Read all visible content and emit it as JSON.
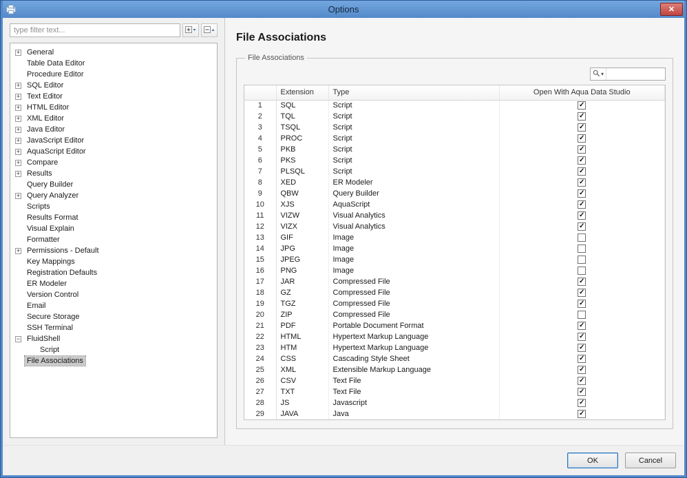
{
  "window": {
    "title": "Options",
    "close_glyph": "✕"
  },
  "colors": {
    "frame_blue": "#5489ca",
    "close_red": "#c14540",
    "selection_gray": "#cbcbcb",
    "default_button_border": "#3173b6"
  },
  "sidebar": {
    "filter_placeholder": "type filter text...",
    "toolbar": [
      {
        "name": "expand-all-button",
        "icon": "expand-all-icon"
      },
      {
        "name": "collapse-all-button",
        "icon": "collapse-all-icon"
      }
    ],
    "tree": [
      {
        "label": "General",
        "exp": "+"
      },
      {
        "label": "Table Data Editor",
        "exp": ""
      },
      {
        "label": "Procedure Editor",
        "exp": ""
      },
      {
        "label": "SQL Editor",
        "exp": "+"
      },
      {
        "label": "Text Editor",
        "exp": "+"
      },
      {
        "label": "HTML Editor",
        "exp": "+"
      },
      {
        "label": "XML Editor",
        "exp": "+"
      },
      {
        "label": "Java Editor",
        "exp": "+"
      },
      {
        "label": "JavaScript Editor",
        "exp": "+"
      },
      {
        "label": "AquaScript Editor",
        "exp": "+"
      },
      {
        "label": "Compare",
        "exp": "+"
      },
      {
        "label": "Results",
        "exp": "+"
      },
      {
        "label": "Query Builder",
        "exp": ""
      },
      {
        "label": "Query Analyzer",
        "exp": "+"
      },
      {
        "label": "Scripts",
        "exp": ""
      },
      {
        "label": "Results Format",
        "exp": ""
      },
      {
        "label": "Visual Explain",
        "exp": ""
      },
      {
        "label": "Formatter",
        "exp": ""
      },
      {
        "label": "Permissions - Default",
        "exp": "+"
      },
      {
        "label": "Key Mappings",
        "exp": ""
      },
      {
        "label": "Registration Defaults",
        "exp": ""
      },
      {
        "label": "ER Modeler",
        "exp": ""
      },
      {
        "label": "Version Control",
        "exp": ""
      },
      {
        "label": "Email",
        "exp": ""
      },
      {
        "label": "Secure Storage",
        "exp": ""
      },
      {
        "label": "SSH Terminal",
        "exp": ""
      },
      {
        "label": "FluidShell",
        "exp": "-"
      },
      {
        "label": "Script",
        "exp": "",
        "level": 1
      },
      {
        "label": "File Associations",
        "exp": "",
        "selected": true
      }
    ]
  },
  "main": {
    "page_title": "File Associations",
    "group_title": "File Associations",
    "search": {
      "value": ""
    },
    "table": {
      "columns": [
        "",
        "Extension",
        "Type",
        "Open With Aqua Data Studio"
      ],
      "rows": [
        {
          "num": 1,
          "extension": "SQL",
          "type": "Script",
          "open_with": true
        },
        {
          "num": 2,
          "extension": "TQL",
          "type": "Script",
          "open_with": true
        },
        {
          "num": 3,
          "extension": "TSQL",
          "type": "Script",
          "open_with": true
        },
        {
          "num": 4,
          "extension": "PROC",
          "type": "Script",
          "open_with": true
        },
        {
          "num": 5,
          "extension": "PKB",
          "type": "Script",
          "open_with": true
        },
        {
          "num": 6,
          "extension": "PKS",
          "type": "Script",
          "open_with": true
        },
        {
          "num": 7,
          "extension": "PLSQL",
          "type": "Script",
          "open_with": true
        },
        {
          "num": 8,
          "extension": "XED",
          "type": "ER Modeler",
          "open_with": true
        },
        {
          "num": 9,
          "extension": "QBW",
          "type": "Query Builder",
          "open_with": true
        },
        {
          "num": 10,
          "extension": "XJS",
          "type": "AquaScript",
          "open_with": true
        },
        {
          "num": 11,
          "extension": "VIZW",
          "type": "Visual Analytics",
          "open_with": true
        },
        {
          "num": 12,
          "extension": "VIZX",
          "type": "Visual Analytics",
          "open_with": true
        },
        {
          "num": 13,
          "extension": "GIF",
          "type": "Image",
          "open_with": false
        },
        {
          "num": 14,
          "extension": "JPG",
          "type": "Image",
          "open_with": false
        },
        {
          "num": 15,
          "extension": "JPEG",
          "type": "Image",
          "open_with": false
        },
        {
          "num": 16,
          "extension": "PNG",
          "type": "Image",
          "open_with": false
        },
        {
          "num": 17,
          "extension": "JAR",
          "type": "Compressed File",
          "open_with": true
        },
        {
          "num": 18,
          "extension": "GZ",
          "type": "Compressed File",
          "open_with": true
        },
        {
          "num": 19,
          "extension": "TGZ",
          "type": "Compressed File",
          "open_with": true
        },
        {
          "num": 20,
          "extension": "ZIP",
          "type": "Compressed File",
          "open_with": false
        },
        {
          "num": 21,
          "extension": "PDF",
          "type": "Portable Document Format",
          "open_with": true
        },
        {
          "num": 22,
          "extension": "HTML",
          "type": "Hypertext Markup Language",
          "open_with": true
        },
        {
          "num": 23,
          "extension": "HTM",
          "type": "Hypertext Markup Language",
          "open_with": true
        },
        {
          "num": 24,
          "extension": "CSS",
          "type": "Cascading Style Sheet",
          "open_with": true
        },
        {
          "num": 25,
          "extension": "XML",
          "type": "Extensible Markup Language",
          "open_with": true
        },
        {
          "num": 26,
          "extension": "CSV",
          "type": "Text File",
          "open_with": true
        },
        {
          "num": 27,
          "extension": "TXT",
          "type": "Text File",
          "open_with": true
        },
        {
          "num": 28,
          "extension": "JS",
          "type": "Javascript",
          "open_with": true
        },
        {
          "num": 29,
          "extension": "JAVA",
          "type": "Java",
          "open_with": true
        }
      ]
    }
  },
  "footer": {
    "ok": "OK",
    "cancel": "Cancel"
  }
}
